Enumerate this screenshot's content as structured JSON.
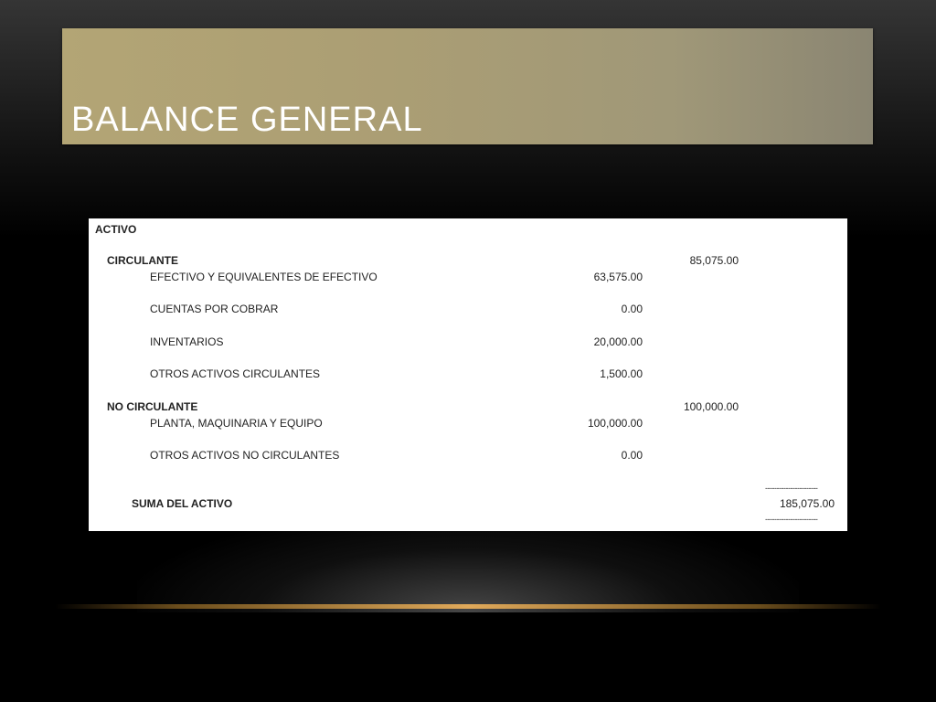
{
  "slide": {
    "title": "BALANCE GENERAL"
  },
  "balance": {
    "section_label": "ACTIVO",
    "circulante": {
      "label": "CIRCULANTE",
      "subtotal": "85,075.00",
      "items": [
        {
          "label": "EFECTIVO Y EQUIVALENTES DE EFECTIVO",
          "value": "63,575.00"
        },
        {
          "label": "CUENTAS POR COBRAR",
          "value": "0.00"
        },
        {
          "label": "INVENTARIOS",
          "value": "20,000.00"
        },
        {
          "label": "OTROS ACTIVOS CIRCULANTES",
          "value": "1,500.00"
        }
      ]
    },
    "no_circulante": {
      "label": "NO CIRCULANTE",
      "subtotal": "100,000.00",
      "items": [
        {
          "label": "PLANTA, MAQUINARIA Y EQUIPO",
          "value": "100,000.00"
        },
        {
          "label": "OTROS ACTIVOS NO CIRCULANTES",
          "value": "0.00"
        }
      ]
    },
    "total": {
      "label": "SUMA DEL ACTIVO",
      "value": "185,075.00",
      "separator": "-----------------------"
    }
  },
  "colors": {
    "title_bar": "#ab9e74",
    "accent_line": "#e0a95a",
    "background": "#000000"
  }
}
